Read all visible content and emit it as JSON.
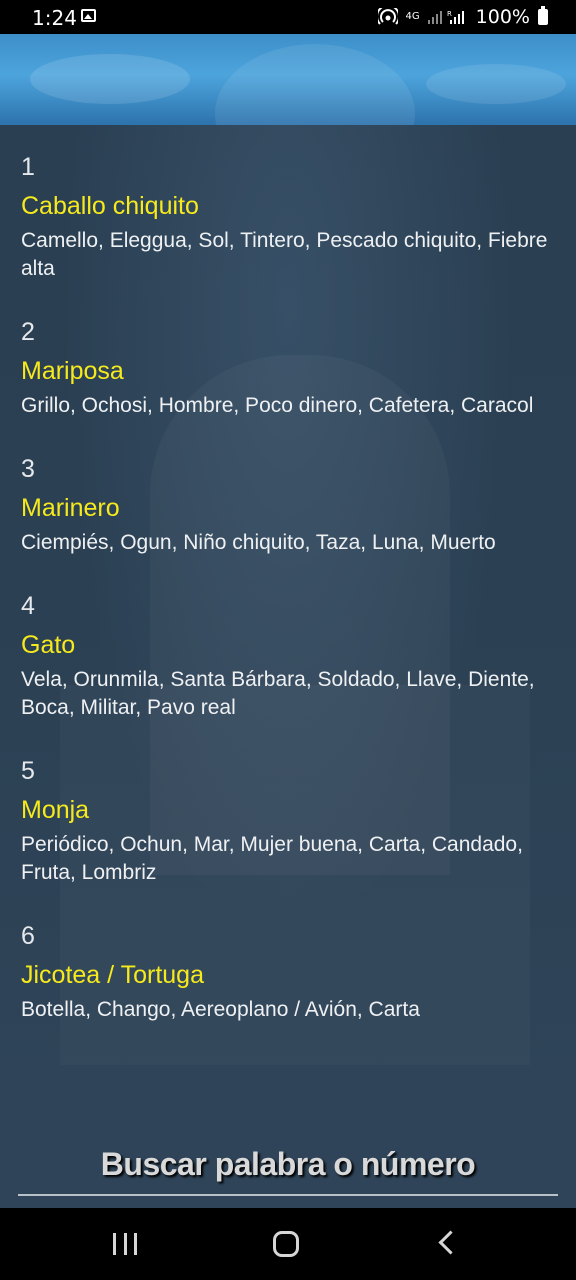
{
  "status_bar": {
    "time": "1:24",
    "network": "4G",
    "signal_small": "R",
    "battery": "100%"
  },
  "entries": [
    {
      "number": "1",
      "title": "Caballo chiquito",
      "desc": "Camello, Eleggua, Sol, Tintero, Pescado chiquito, Fiebre alta"
    },
    {
      "number": "2",
      "title": "Mariposa",
      "desc": "Grillo, Ochosi, Hombre, Poco dinero, Cafetera, Caracol"
    },
    {
      "number": "3",
      "title": "Marinero",
      "desc": "Ciempiés, Ogun, Niño chiquito, Taza, Luna, Muerto"
    },
    {
      "number": "4",
      "title": "Gato",
      "desc": "Vela, Orunmila, Santa Bárbara, Soldado, Llave, Diente, Boca, Militar, Pavo real"
    },
    {
      "number": "5",
      "title": "Monja",
      "desc": "Periódico, Ochun, Mar, Mujer buena, Carta, Candado, Fruta, Lombriz"
    },
    {
      "number": "6",
      "title": "Jicotea / Tortuga",
      "desc": "Botella, Chango, Aereoplano / Avión, Carta"
    }
  ],
  "search": {
    "label": "Buscar palabra o número"
  },
  "colors": {
    "title_yellow": "#f6ea1c",
    "content_bg": "#2b4053",
    "banner_blue": "#4da4dc"
  },
  "icons": [
    "image-icon",
    "hotspot-icon",
    "signal-icon",
    "battery-icon",
    "recents-icon",
    "home-icon",
    "back-icon"
  ]
}
